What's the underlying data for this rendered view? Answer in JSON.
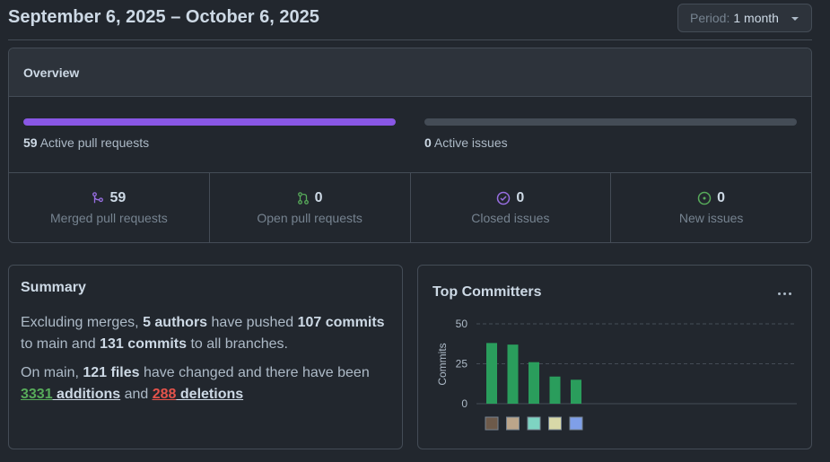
{
  "header": {
    "title": "September 6, 2025 – October 6, 2025",
    "period_label": "Period:",
    "period_value": "1 month"
  },
  "overview": {
    "title": "Overview",
    "pull_requests": {
      "count": "59",
      "label": "Active pull requests",
      "fill_fraction": 1.0
    },
    "issues": {
      "count": "0",
      "label": "Active issues",
      "fill_fraction": 0.0
    },
    "stats": [
      {
        "value": "59",
        "label": "Merged pull requests",
        "icon": "merge-icon",
        "color": "#986ee2"
      },
      {
        "value": "0",
        "label": "Open pull requests",
        "icon": "pull-request-icon",
        "color": "#57ab5a"
      },
      {
        "value": "0",
        "label": "Closed issues",
        "icon": "issue-closed-icon",
        "color": "#986ee2"
      },
      {
        "value": "0",
        "label": "New issues",
        "icon": "issue-opened-icon",
        "color": "#57ab5a"
      }
    ]
  },
  "summary": {
    "title": "Summary",
    "p1_a": "Excluding merges, ",
    "authors": "5 authors",
    "p1_b": " have pushed ",
    "commits_main": "107 commits",
    "p1_c": " to main and ",
    "commits_all": "131 commits",
    "p1_d": " to all branches.",
    "p2_a": "On main, ",
    "files": "121 files",
    "p2_b": " have changed and there have been ",
    "additions_num": "3331",
    "additions_word": " additions",
    "p2_c": " and ",
    "deletions_num": "288",
    "deletions_word": " deletions"
  },
  "committers": {
    "title": "Top Committers",
    "more_icon": "kebab-horizontal-icon"
  },
  "chart_data": {
    "type": "bar",
    "ylabel": "Commits",
    "ylim": [
      0,
      50
    ],
    "yticks": [
      "0",
      "25",
      "50"
    ],
    "grid": true,
    "bar_color": "#2a9d5c",
    "values": [
      38,
      37,
      26,
      17,
      15
    ],
    "categories_icons": [
      "avatar-1",
      "avatar-2",
      "avatar-3",
      "avatar-4",
      "avatar-5"
    ]
  }
}
